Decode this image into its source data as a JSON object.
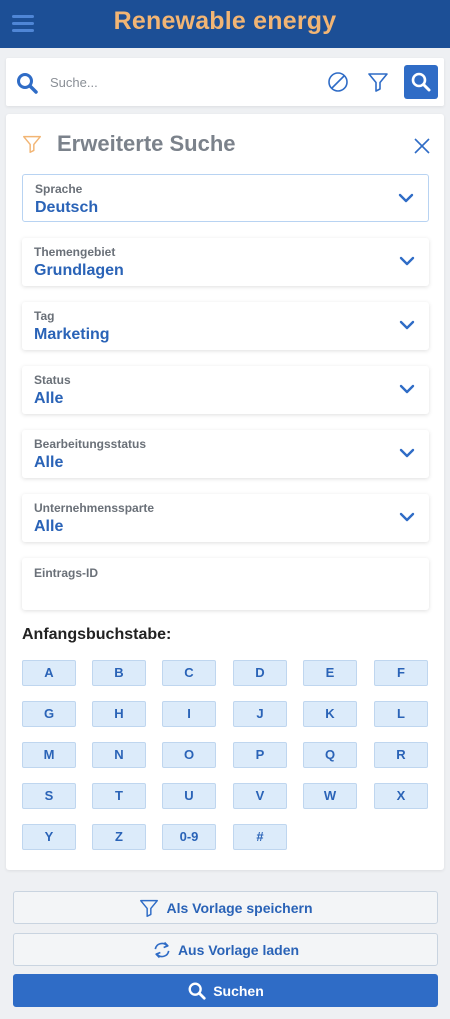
{
  "header": {
    "title": "Renewable energy"
  },
  "search": {
    "placeholder": "Suche..."
  },
  "panel": {
    "title": "Erweiterte Suche"
  },
  "fields": [
    {
      "label": "Sprache",
      "value": "Deutsch"
    },
    {
      "label": "Themengebiet",
      "value": "Grundlagen"
    },
    {
      "label": "Tag",
      "value": "Marketing"
    },
    {
      "label": "Status",
      "value": "Alle"
    },
    {
      "label": "Bearbeitungsstatus",
      "value": "Alle"
    },
    {
      "label": "Unternehmenssparte",
      "value": "Alle"
    }
  ],
  "entry_id": {
    "label": "Eintrags-ID",
    "value": ""
  },
  "letters": {
    "heading": "Anfangsbuchstabe:",
    "items": [
      "A",
      "B",
      "C",
      "D",
      "E",
      "F",
      "G",
      "H",
      "I",
      "J",
      "K",
      "L",
      "M",
      "N",
      "O",
      "P",
      "Q",
      "R",
      "S",
      "T",
      "U",
      "V",
      "W",
      "X",
      "Y",
      "Z",
      "0-9",
      "#"
    ]
  },
  "actions": {
    "save_template": "Als Vorlage speichern",
    "load_template": "Aus Vorlage laden",
    "search": "Suchen"
  },
  "colors": {
    "header_bg": "#1c4f96",
    "title": "#f2b574",
    "accent": "#2f6cc6"
  },
  "icons": [
    "menu-icon",
    "search-icon",
    "clear-icon",
    "filter-icon",
    "close-icon",
    "chevron-down-icon",
    "refresh-icon"
  ]
}
